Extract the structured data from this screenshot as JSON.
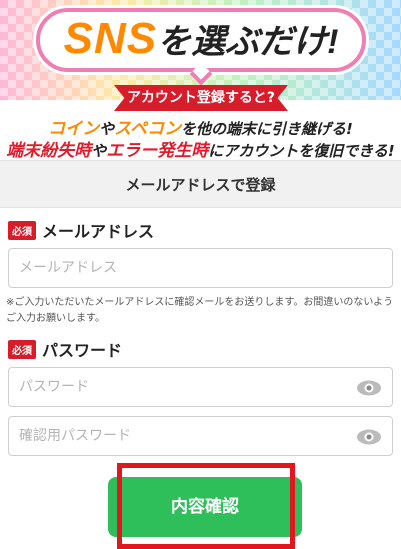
{
  "banner": {
    "title_sns": "SNS",
    "title_rest": "を選ぶだけ!",
    "ribbon": "アカウント登録すると?",
    "line1": {
      "part_a": "コイン",
      "part_b": "や",
      "part_c": "スペコン",
      "part_d": "を他の端末に引き継げる!"
    },
    "line2": {
      "part_a": "端末紛失時",
      "part_b": "や",
      "part_c": "エラー発生時",
      "part_d": "にアカウントを復旧できる!"
    },
    "colors": {
      "orange": "#ff8a00",
      "red": "#e21b2b",
      "pink_border": "#ef7fb3"
    }
  },
  "section": {
    "title": "メールアドレスで登録"
  },
  "email": {
    "required_badge": "必須",
    "label": "メールアドレス",
    "placeholder": "メールアドレス",
    "value": "",
    "note": "※ご入力いただいたメールアドレスに確認メールをお送りします。お間違いのないようご入力お願いします。"
  },
  "password": {
    "required_badge": "必須",
    "label": "パスワード",
    "placeholder": "パスワード",
    "value": "",
    "confirm_placeholder": "確認用パスワード",
    "confirm_value": "",
    "eye_icon": "eye-icon"
  },
  "submit": {
    "label": "内容確認",
    "color": "#2ebf5a",
    "highlight_color": "#e1161f"
  }
}
